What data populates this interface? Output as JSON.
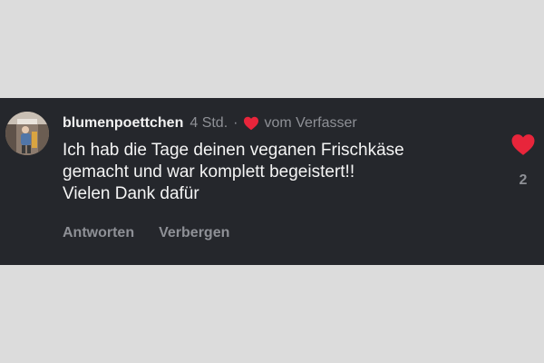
{
  "comment": {
    "username": "blumenpoettchen",
    "time": "4 Std.",
    "separator": "·",
    "author_badge": "vom Verfasser",
    "text_lines": [
      "Ich hab die Tage deinen veganen Frischkäse",
      "gemacht und war komplett begeistert!!",
      "Vielen Dank dafür"
    ],
    "actions": {
      "reply_label": "Antworten",
      "hide_label": "Verbergen"
    },
    "like_count": "2"
  },
  "colors": {
    "card_background": "#25272c",
    "page_background": "#dcdcdc",
    "heart": "#e8253b",
    "muted_text": "#8e9096",
    "primary_text": "#f4f4f4"
  },
  "icons": {
    "author_like": "heart-icon",
    "comment_like": "heart-icon"
  }
}
